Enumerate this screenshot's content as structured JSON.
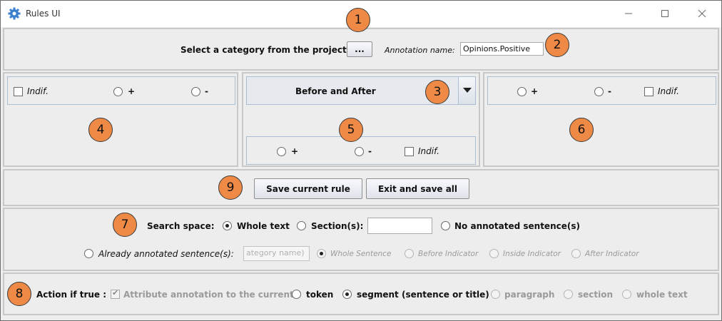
{
  "window": {
    "title": "Rules UI",
    "minimize_icon": "minimize-icon",
    "maximize_icon": "maximize-icon",
    "close_icon": "close-icon"
  },
  "category": {
    "label": "Select a category from the project:",
    "browse_label": "...",
    "annotation_label": "Annotation name:",
    "annotation_value": "Opinions.Positive"
  },
  "before": {
    "indif_label": "Indif.",
    "plus_label": "+",
    "minus_label": "-"
  },
  "middle": {
    "dropdown_value": "Before and After",
    "plus_label": "+",
    "minus_label": "-",
    "indif_label": "Indif."
  },
  "after": {
    "plus_label": "+",
    "minus_label": "-",
    "indif_label": "Indif."
  },
  "actions": {
    "save_label": "Save current rule",
    "exit_label": "Exit and save all"
  },
  "search": {
    "label": "Search space:",
    "whole_text": "Whole text",
    "sections": "Section(s):",
    "sections_value": "",
    "no_annotated": "No annotated sentence(s)",
    "already_annotated": "Already annotated sentence(s):",
    "category_placeholder": "ategory name)",
    "whole_sentence": "Whole Sentence",
    "before_indicator": "Before Indicator",
    "inside_indicator": "Inside Indicator",
    "after_indicator": "After Indicator"
  },
  "action_if_true": {
    "label": "Action if true :",
    "attribute_label": "Attribute annotation to the current:",
    "token": "token",
    "segment": "segment (sentence or title)",
    "paragraph": "paragraph",
    "section": "section",
    "whole_text": "whole text"
  },
  "callouts": [
    "1",
    "2",
    "3",
    "4",
    "5",
    "6",
    "7",
    "8",
    "9"
  ],
  "colors": {
    "callout": "#ef8a46",
    "panel_border": "#c8c8c8",
    "inner_border": "#a9bdd3"
  }
}
